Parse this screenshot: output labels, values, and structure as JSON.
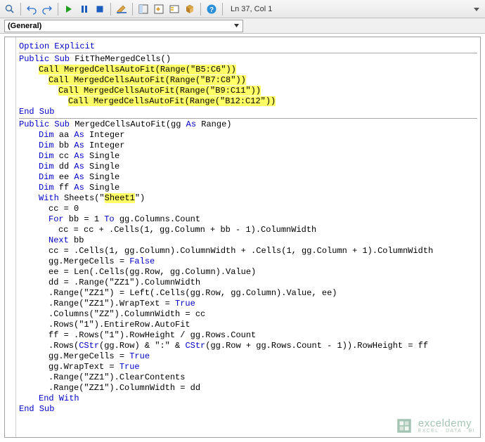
{
  "status": {
    "line": 37,
    "col": 1,
    "text": "Ln 37, Col 1"
  },
  "object_dropdown": "(General)",
  "icons": [
    "find",
    "undo",
    "redo",
    "run",
    "pause",
    "stop",
    "design",
    "proj",
    "props",
    "browser",
    "toolbox",
    "help"
  ],
  "watermark": {
    "brand": "exceldemy",
    "tagline": "EXCEL · DATA · BI"
  },
  "code": {
    "l1": "Option Explicit",
    "l2a": "Public Sub",
    "l2b": " FitTheMergedCells()",
    "l3": "Call MergedCellsAutoFit(Range(\"B5:C6\"))",
    "l4": "Call MergedCellsAutoFit(Range(\"B7:C8\"))",
    "l5": "Call MergedCellsAutoFit(Range(\"B9:C11\"))",
    "l6": "Call MergedCellsAutoFit(Range(\"B12:C12\"))",
    "l7": "End Sub",
    "l8a": "Public Sub",
    "l8b": " MergedCellsAutoFit(gg ",
    "l8c": "As",
    "l8d": " Range)",
    "dim_aa": "Dim",
    "dim_aa2": " aa ",
    "dim_aa3": "As",
    "dim_aa4": " Integer",
    "dim_bb": "Dim",
    "dim_bb2": " bb ",
    "dim_bb3": "As",
    "dim_bb4": " Integer",
    "dim_cc": "Dim",
    "dim_cc2": " cc ",
    "dim_cc3": "As",
    "dim_cc4": " Single",
    "dim_dd": "Dim",
    "dim_dd2": " dd ",
    "dim_dd3": "As",
    "dim_dd4": " Single",
    "dim_ee": "Dim",
    "dim_ee2": " ee ",
    "dim_ee3": "As",
    "dim_ee4": " Single",
    "dim_ff": "Dim",
    "dim_ff2": " ff ",
    "dim_ff3": "As",
    "dim_ff4": " Single",
    "with": "With",
    "with2": " Sheets(\"",
    "sheet": "Sheet1",
    "with3": "\")",
    "b1": "cc = 0",
    "for": "For",
    "b2": " bb = 1 ",
    "to": "To",
    "b3": " gg.Columns.Count",
    "b4": "cc = cc + .Cells(1, gg.Column + bb - 1).ColumnWidth",
    "next": "Next",
    "b5": " bb",
    "b6": "cc = .Cells(1, gg.Column).ColumnWidth + .Cells(1, gg.Column + 1).ColumnWidth",
    "b7": "gg.MergeCells = ",
    "false": "False",
    "b8": "ee = Len(.Cells(gg.Row, gg.Column).Value)",
    "b9": "dd = .Range(\"ZZ1\").ColumnWidth",
    "b10": ".Range(\"ZZ1\") = Left(.Cells(gg.Row, gg.Column).Value, ee)",
    "b11": ".Range(\"ZZ1\").WrapText = ",
    "true": "True",
    "b12": ".Columns(\"ZZ\").ColumnWidth = cc",
    "b13": ".Rows(\"1\").EntireRow.AutoFit",
    "b14": "ff = .Rows(\"1\").RowHeight / gg.Rows.Count",
    "b15a": ".Rows(",
    "cstr": "CStr",
    "b15b": "(gg.Row) & \":\" & ",
    "b15c": "(gg.Row + gg.Rows.Count - 1)).RowHeight = ff",
    "b16": "gg.MergeCells = ",
    "b17": "gg.WrapText = ",
    "b18": ".Range(\"ZZ1\").ClearContents",
    "b19": ".Range(\"ZZ1\").ColumnWidth = dd",
    "endwith": "End With",
    "endsub": "End Sub"
  }
}
